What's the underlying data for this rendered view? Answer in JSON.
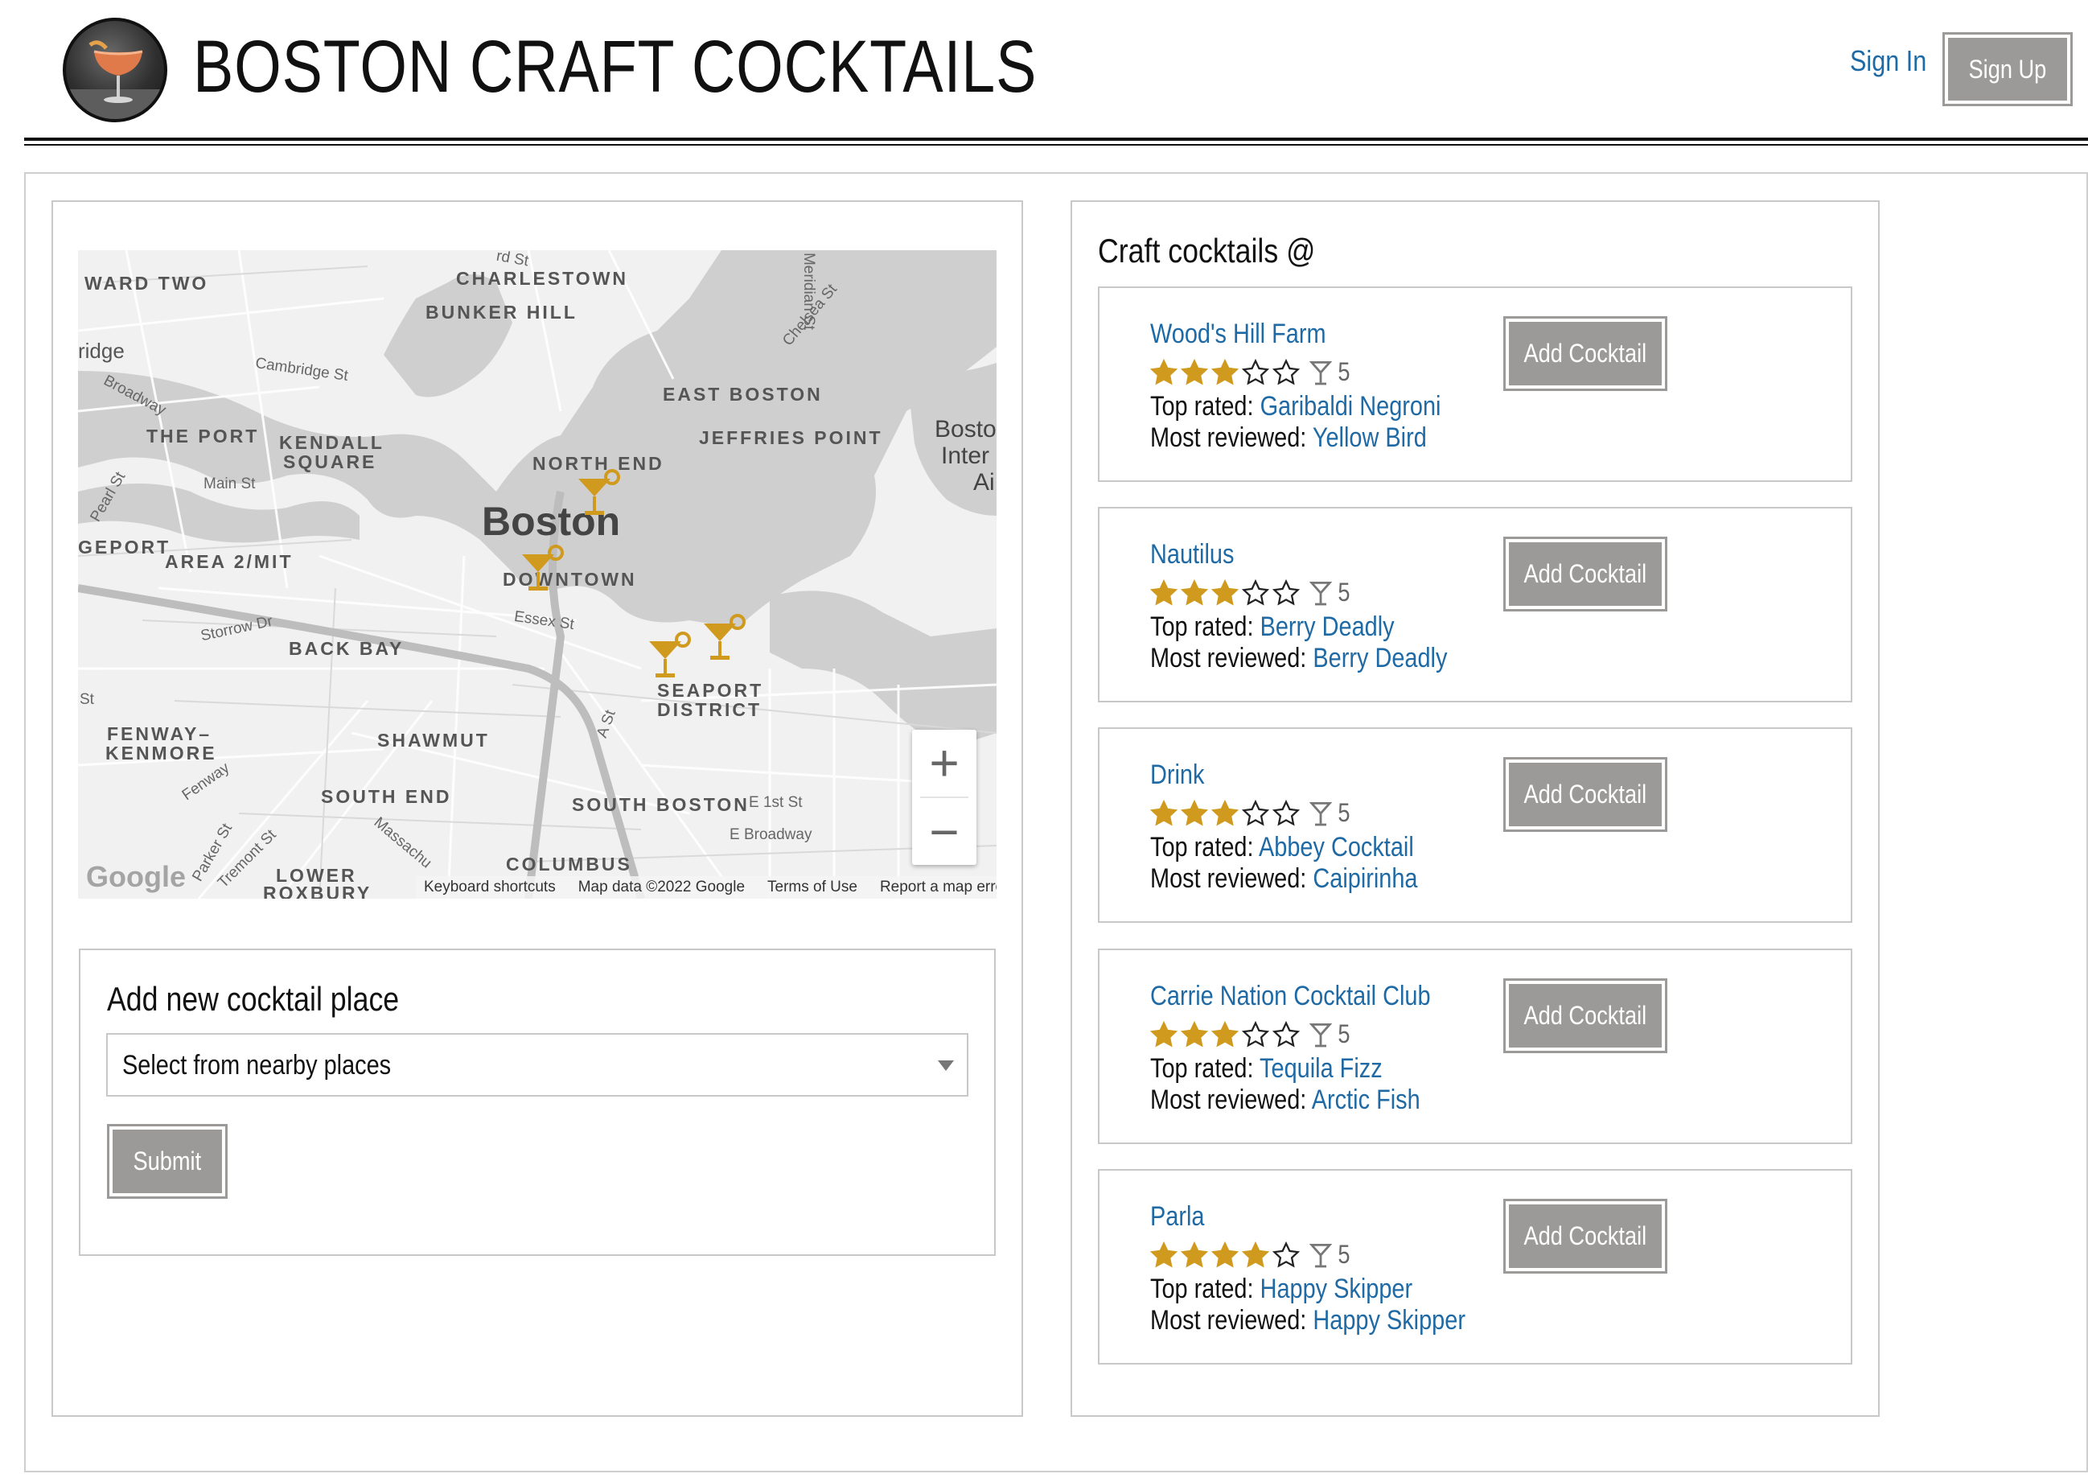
{
  "header": {
    "title": "BOSTON CRAFT COCKTAILS",
    "sign_in": "Sign In",
    "sign_up": "Sign Up"
  },
  "map": {
    "neighborhoods": [
      "WARD TWO",
      "CHARLESTOWN",
      "BUNKER HILL",
      "THE PORT",
      "KENDALL",
      "SQUARE",
      "EAST BOSTON",
      "JEFFRIES POINT",
      "NORTH END",
      "DOWNTOWN",
      "AREA 2/MIT",
      "GEPORT",
      "BACK BAY",
      "SEAPORT",
      "DISTRICT",
      "FENWAY–",
      "KENMORE",
      "SHAWMUT",
      "SOUTH END",
      "SOUTH BOSTON",
      "COLUMBUS",
      "LOWER",
      "ROXBURY"
    ],
    "streets": [
      "Cambridge St",
      "Broadway",
      "Main St",
      "Pearl St",
      "Storrow Dr",
      "Essex St",
      "Meridian St",
      "Chelsea St",
      "A St",
      "E 1st St",
      "E Broadway",
      "Fenway",
      "Parker St",
      "Tremont St",
      "Massachu",
      "ridge",
      "St",
      "rd St"
    ],
    "city": "Boston",
    "airport_partial": [
      "Bosto",
      "Inter",
      "Ai"
    ],
    "zoom_in": "+",
    "zoom_out": "−",
    "google": "Google",
    "footer": [
      "Keyboard shortcuts",
      "Map data ©2022 Google",
      "Terms of Use",
      "Report a map error"
    ],
    "accent_color": "#d09a1e"
  },
  "add_place": {
    "title": "Add new cocktail place",
    "select_value": "Select from nearby places",
    "submit": "Submit"
  },
  "list": {
    "title": "Craft cocktails @",
    "top_label": "Top rated:",
    "most_label": "Most reviewed:",
    "button_label": "Add Cocktail",
    "places": [
      {
        "name": "Wood's Hill Farm",
        "rating": 3,
        "count": "5",
        "top": "Garibaldi Negroni",
        "most": "Yellow Bird"
      },
      {
        "name": "Nautilus",
        "rating": 3,
        "count": "5",
        "top": "Berry Deadly",
        "most": "Berry Deadly"
      },
      {
        "name": "Drink",
        "rating": 3,
        "count": "5",
        "top": "Abbey Cocktail",
        "most": "Caipirinha"
      },
      {
        "name": "Carrie Nation Cocktail Club",
        "rating": 3,
        "count": "5",
        "top": "Tequila Fizz",
        "most": "Arctic Fish"
      },
      {
        "name": "Parla",
        "rating": 4,
        "count": "5",
        "top": "Happy Skipper",
        "most": "Happy Skipper"
      }
    ]
  },
  "colors": {
    "link": "#1f6aa5",
    "button": "#9c9999",
    "star": "#d09a1e"
  }
}
